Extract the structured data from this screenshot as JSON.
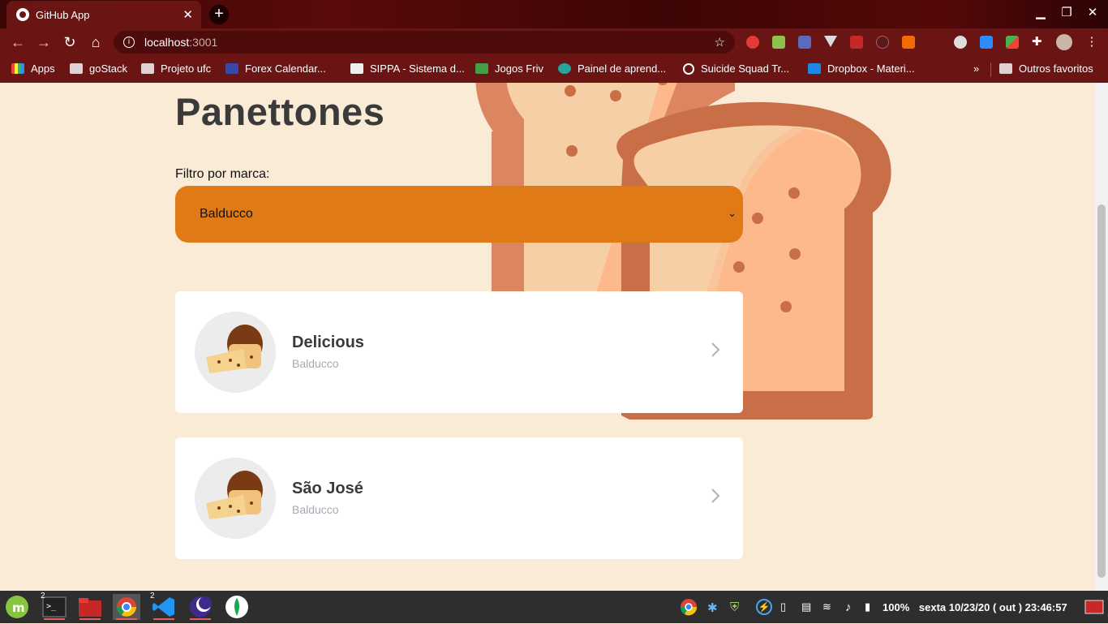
{
  "browser": {
    "tab_title": "GitHub App",
    "new_tab": "+",
    "tab_close": "✕",
    "url_host": "localhost",
    "url_port": ":3001",
    "bookmarks": [
      {
        "label": "Apps"
      },
      {
        "label": "goStack"
      },
      {
        "label": "Projeto ufc"
      },
      {
        "label": "Forex Calendar..."
      },
      {
        "label": "SIPPA - Sistema d..."
      },
      {
        "label": "Jogos Friv"
      },
      {
        "label": "Painel de aprend..."
      },
      {
        "label": "Suicide Squad Tr..."
      },
      {
        "label": "Dropbox - Materi..."
      }
    ],
    "more_bookmarks": "»",
    "other_bookmarks": "Outros favoritos"
  },
  "page": {
    "title": "Panettones",
    "filter_label": "Filtro por marca:",
    "selected_brand": "Balducco",
    "products": [
      {
        "name": "Delicious",
        "brand": "Balducco"
      },
      {
        "name": "São José",
        "brand": "Balducco"
      }
    ]
  },
  "colors": {
    "accent_select": "#e07a17",
    "page_bg": "#faebd7",
    "chrome_bg": "#6b1414"
  },
  "taskbar": {
    "badge_terminal": "2",
    "badge_vscode": "2",
    "battery": "100%",
    "datetime": "sexta  10/23/20 ( out ) 23:46:57"
  }
}
